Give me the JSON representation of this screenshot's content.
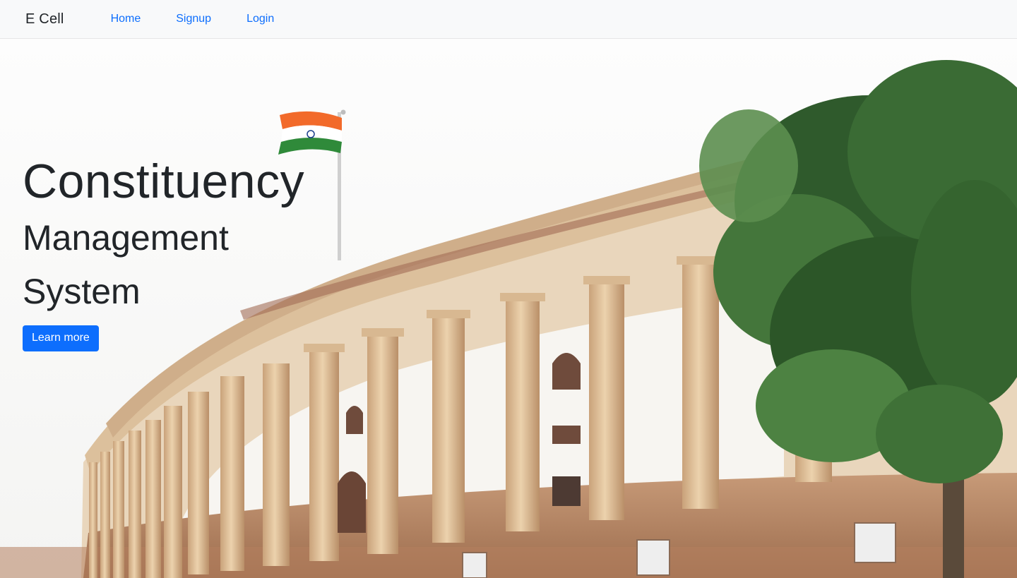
{
  "navbar": {
    "brand": "E Cell",
    "links": [
      {
        "label": "Home"
      },
      {
        "label": "Signup"
      },
      {
        "label": "Login"
      }
    ],
    "link_color": "#0d6efd"
  },
  "hero": {
    "title": "Constituency",
    "subtitle_line1": "Management",
    "subtitle_line2": "System",
    "cta_label": "Learn more",
    "cta_color": "#0d6efd",
    "background_image": "parliament-building-with-flag-and-tree"
  }
}
